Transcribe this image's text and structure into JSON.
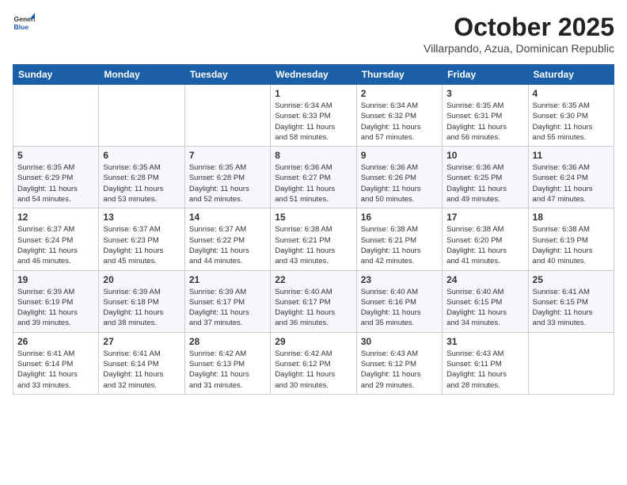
{
  "header": {
    "logo": {
      "general": "General",
      "blue": "Blue"
    },
    "title": "October 2025",
    "subtitle": "Villarpando, Azua, Dominican Republic"
  },
  "weekdays": [
    "Sunday",
    "Monday",
    "Tuesday",
    "Wednesday",
    "Thursday",
    "Friday",
    "Saturday"
  ],
  "weeks": [
    [
      {
        "day": "",
        "info": ""
      },
      {
        "day": "",
        "info": ""
      },
      {
        "day": "",
        "info": ""
      },
      {
        "day": "1",
        "info": "Sunrise: 6:34 AM\nSunset: 6:33 PM\nDaylight: 11 hours\nand 58 minutes."
      },
      {
        "day": "2",
        "info": "Sunrise: 6:34 AM\nSunset: 6:32 PM\nDaylight: 11 hours\nand 57 minutes."
      },
      {
        "day": "3",
        "info": "Sunrise: 6:35 AM\nSunset: 6:31 PM\nDaylight: 11 hours\nand 56 minutes."
      },
      {
        "day": "4",
        "info": "Sunrise: 6:35 AM\nSunset: 6:30 PM\nDaylight: 11 hours\nand 55 minutes."
      }
    ],
    [
      {
        "day": "5",
        "info": "Sunrise: 6:35 AM\nSunset: 6:29 PM\nDaylight: 11 hours\nand 54 minutes."
      },
      {
        "day": "6",
        "info": "Sunrise: 6:35 AM\nSunset: 6:28 PM\nDaylight: 11 hours\nand 53 minutes."
      },
      {
        "day": "7",
        "info": "Sunrise: 6:35 AM\nSunset: 6:28 PM\nDaylight: 11 hours\nand 52 minutes."
      },
      {
        "day": "8",
        "info": "Sunrise: 6:36 AM\nSunset: 6:27 PM\nDaylight: 11 hours\nand 51 minutes."
      },
      {
        "day": "9",
        "info": "Sunrise: 6:36 AM\nSunset: 6:26 PM\nDaylight: 11 hours\nand 50 minutes."
      },
      {
        "day": "10",
        "info": "Sunrise: 6:36 AM\nSunset: 6:25 PM\nDaylight: 11 hours\nand 49 minutes."
      },
      {
        "day": "11",
        "info": "Sunrise: 6:36 AM\nSunset: 6:24 PM\nDaylight: 11 hours\nand 47 minutes."
      }
    ],
    [
      {
        "day": "12",
        "info": "Sunrise: 6:37 AM\nSunset: 6:24 PM\nDaylight: 11 hours\nand 46 minutes."
      },
      {
        "day": "13",
        "info": "Sunrise: 6:37 AM\nSunset: 6:23 PM\nDaylight: 11 hours\nand 45 minutes."
      },
      {
        "day": "14",
        "info": "Sunrise: 6:37 AM\nSunset: 6:22 PM\nDaylight: 11 hours\nand 44 minutes."
      },
      {
        "day": "15",
        "info": "Sunrise: 6:38 AM\nSunset: 6:21 PM\nDaylight: 11 hours\nand 43 minutes."
      },
      {
        "day": "16",
        "info": "Sunrise: 6:38 AM\nSunset: 6:21 PM\nDaylight: 11 hours\nand 42 minutes."
      },
      {
        "day": "17",
        "info": "Sunrise: 6:38 AM\nSunset: 6:20 PM\nDaylight: 11 hours\nand 41 minutes."
      },
      {
        "day": "18",
        "info": "Sunrise: 6:38 AM\nSunset: 6:19 PM\nDaylight: 11 hours\nand 40 minutes."
      }
    ],
    [
      {
        "day": "19",
        "info": "Sunrise: 6:39 AM\nSunset: 6:19 PM\nDaylight: 11 hours\nand 39 minutes."
      },
      {
        "day": "20",
        "info": "Sunrise: 6:39 AM\nSunset: 6:18 PM\nDaylight: 11 hours\nand 38 minutes."
      },
      {
        "day": "21",
        "info": "Sunrise: 6:39 AM\nSunset: 6:17 PM\nDaylight: 11 hours\nand 37 minutes."
      },
      {
        "day": "22",
        "info": "Sunrise: 6:40 AM\nSunset: 6:17 PM\nDaylight: 11 hours\nand 36 minutes."
      },
      {
        "day": "23",
        "info": "Sunrise: 6:40 AM\nSunset: 6:16 PM\nDaylight: 11 hours\nand 35 minutes."
      },
      {
        "day": "24",
        "info": "Sunrise: 6:40 AM\nSunset: 6:15 PM\nDaylight: 11 hours\nand 34 minutes."
      },
      {
        "day": "25",
        "info": "Sunrise: 6:41 AM\nSunset: 6:15 PM\nDaylight: 11 hours\nand 33 minutes."
      }
    ],
    [
      {
        "day": "26",
        "info": "Sunrise: 6:41 AM\nSunset: 6:14 PM\nDaylight: 11 hours\nand 33 minutes."
      },
      {
        "day": "27",
        "info": "Sunrise: 6:41 AM\nSunset: 6:14 PM\nDaylight: 11 hours\nand 32 minutes."
      },
      {
        "day": "28",
        "info": "Sunrise: 6:42 AM\nSunset: 6:13 PM\nDaylight: 11 hours\nand 31 minutes."
      },
      {
        "day": "29",
        "info": "Sunrise: 6:42 AM\nSunset: 6:12 PM\nDaylight: 11 hours\nand 30 minutes."
      },
      {
        "day": "30",
        "info": "Sunrise: 6:43 AM\nSunset: 6:12 PM\nDaylight: 11 hours\nand 29 minutes."
      },
      {
        "day": "31",
        "info": "Sunrise: 6:43 AM\nSunset: 6:11 PM\nDaylight: 11 hours\nand 28 minutes."
      },
      {
        "day": "",
        "info": ""
      }
    ]
  ]
}
